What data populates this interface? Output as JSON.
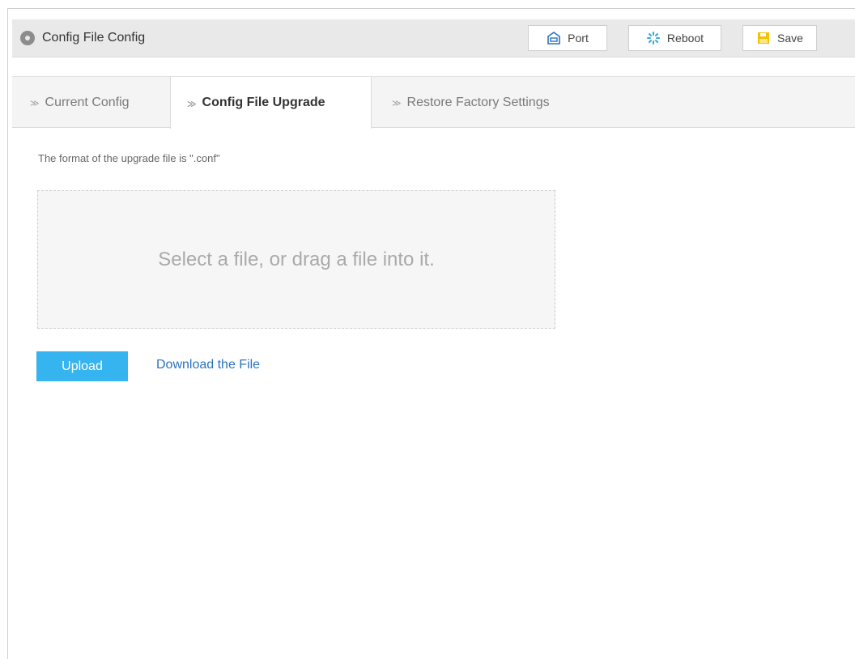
{
  "header": {
    "title": "Config File Config",
    "icon": "circle-icon",
    "buttons": {
      "port": {
        "label": "Port",
        "icon": "port-icon"
      },
      "reboot": {
        "label": "Reboot",
        "icon": "reboot-icon"
      },
      "save": {
        "label": "Save",
        "icon": "save-icon"
      }
    }
  },
  "tabs": [
    {
      "label": "Current Config",
      "active": false
    },
    {
      "label": "Config File Upgrade",
      "active": true
    },
    {
      "label": "Restore Factory Settings",
      "active": false
    }
  ],
  "main": {
    "hint": "The format of the upgrade file is \".conf\"",
    "dropzone_text": "Select a file, or drag a file into it.",
    "upload_label": "Upload",
    "download_label": "Download the File"
  },
  "colors": {
    "accent": "#35b4ef",
    "link": "#2a73c0",
    "header_bg": "#e9e9e9",
    "save_icon": "#f2c200",
    "port_icon": "#2a73c0"
  }
}
